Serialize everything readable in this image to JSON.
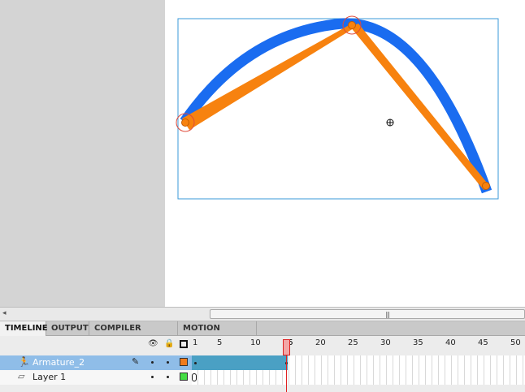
{
  "timeline": {
    "tabs": [
      {
        "label": "TIMELINE",
        "active": true
      },
      {
        "label": "OUTPUT",
        "active": false
      },
      {
        "label": "COMPILER ERRORS",
        "active": false
      },
      {
        "label": "MOTION EDITOR",
        "active": false
      }
    ],
    "header_icons": [
      "eye-icon",
      "lock-icon",
      "outline-icon"
    ],
    "ruler": [
      "1",
      "5",
      "10",
      "15",
      "20",
      "25",
      "30",
      "35",
      "40",
      "45",
      "50"
    ],
    "current_frame": "15",
    "layers": [
      {
        "name": "Armature_2",
        "icon": "armature-icon",
        "selected": true,
        "color": "#f07b1c"
      },
      {
        "name": "Layer 1",
        "icon": "layer-icon",
        "selected": false,
        "color": "#44dd44"
      }
    ]
  },
  "stage": {
    "background": "#ffffff",
    "shape_color": "#1a6cf0",
    "bone_color": "#f7820f",
    "joint_color": "#e04a3a"
  },
  "colors": {
    "pasteboard": "#d4d4d4",
    "selection": "#8fbde8",
    "pose_span": "#4aa0c4",
    "playhead": "#e02020"
  }
}
